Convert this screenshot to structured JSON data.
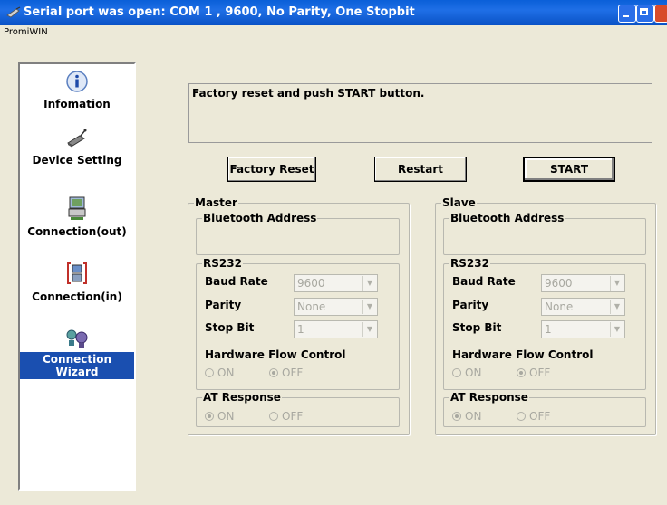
{
  "window": {
    "title": "Serial port was open: COM 1 , 9600, No Parity, One Stopbit",
    "menu_app": "PromiWIN"
  },
  "sidebar": {
    "items": [
      {
        "label": "Infomation",
        "icon": "info-icon"
      },
      {
        "label": "Device Setting",
        "icon": "device-icon"
      },
      {
        "label": "Connection(out)",
        "icon": "connection-out-icon"
      },
      {
        "label": "Connection(in)",
        "icon": "connection-in-icon"
      },
      {
        "label": "Connection Wizard",
        "icon": "wizard-icon",
        "selected": true
      }
    ]
  },
  "main": {
    "message": "Factory reset and push START button.",
    "buttons": {
      "factory_reset": "Factory Reset",
      "restart": "Restart",
      "start": "START"
    }
  },
  "master": {
    "title": "Master",
    "bt_address_label": "Bluetooth Address",
    "rs232_label": "RS232",
    "baud_label": "Baud Rate",
    "baud_value": "9600",
    "parity_label": "Parity",
    "parity_value": "None",
    "stop_label": "Stop Bit",
    "stop_value": "1",
    "hfc_label": "Hardware Flow Control",
    "hfc_on": "ON",
    "hfc_off": "OFF",
    "hfc_selected": "OFF",
    "at_label": "AT Response",
    "at_on": "ON",
    "at_off": "OFF",
    "at_selected": "ON"
  },
  "slave": {
    "title": "Slave",
    "bt_address_label": "Bluetooth Address",
    "rs232_label": "RS232",
    "baud_label": "Baud Rate",
    "baud_value": "9600",
    "parity_label": "Parity",
    "parity_value": "None",
    "stop_label": "Stop Bit",
    "stop_value": "1",
    "hfc_label": "Hardware Flow Control",
    "hfc_on": "ON",
    "hfc_off": "OFF",
    "hfc_selected": "OFF",
    "at_label": "AT Response",
    "at_on": "ON",
    "at_off": "OFF",
    "at_selected": "ON"
  },
  "colors": {
    "titlebar": "#0a5fd8",
    "selected_item": "#1a4fb0",
    "window_bg": "#ece9d8"
  }
}
